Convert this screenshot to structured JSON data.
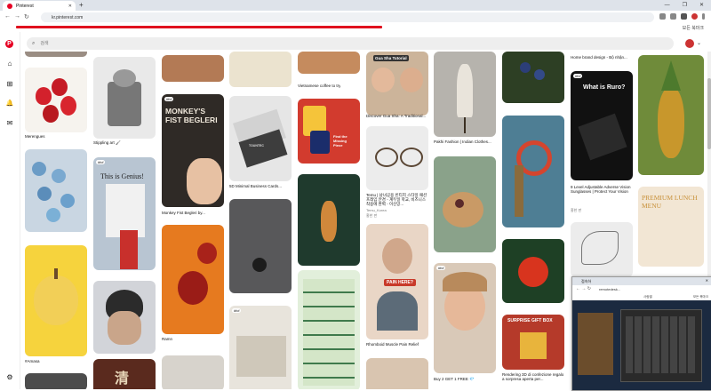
{
  "browser": {
    "tab_title": "Pinterest",
    "tab_close": "✕",
    "new_tab": "+",
    "url": "kr.pinterest.com",
    "bookmarks_label": "모든 북마크",
    "window_buttons": [
      "—",
      "❐",
      "✕"
    ],
    "colors": {
      "tabbar": "#dee3ea",
      "progress": "#e0101e",
      "brand": "#e60023"
    }
  },
  "sidebar": {
    "items": [
      {
        "name": "pinterest-logo-icon",
        "glyph": "P"
      },
      {
        "name": "home-icon",
        "glyph": "⌂"
      },
      {
        "name": "create-icon",
        "glyph": "⊞"
      },
      {
        "name": "notifications-icon",
        "glyph": "🔔"
      },
      {
        "name": "messages-icon",
        "glyph": "✉"
      },
      {
        "name": "settings-icon",
        "glyph": "⚙"
      }
    ]
  },
  "search": {
    "placeholder": "검색",
    "icon": "⌕"
  },
  "pins": {
    "c1": [
      "Merengues",
      "#Amasa"
    ],
    "c2": [
      "Stippling art 🖌",
      "This is Genius!",
      "#fcf",
      "清"
    ],
    "c3": [
      "MONKEY'S FIST BEGLERI",
      "Monkey Fist Begleri by...",
      "#fcf"
    ],
    "c4": [
      "5D Minimal Business Cards...",
      "TOUNTEC"
    ],
    "c5": [
      "Vietnamese coffee to try",
      "Find the Missing Piece",
      "Find the Missing Piece"
    ],
    "c6": [
      "Gua Sha Tutorial",
      "Discover Gua Sha: A Traditional...",
      "Temu | 남녀공용 빈티지 스타일 패션 프레임 안경 - 계두일 학교, 비즈니스 착용에 완벽 - 이신망...",
      "Temu_Korea",
      "홍한 판",
      "PAIN HERE?",
      "Rhomboid Muscle Pain Relief"
    ],
    "c7": [
      "Pakhi Fashion | Indian Clothes...",
      "Buy 2 GET 1 FREE 💎",
      "#fcf"
    ],
    "c8": [
      "Rendering 3D di confezione regalo a sorpresa aperta per...",
      "SURPRISE GIFT BOX"
    ],
    "c9": [
      "Home brand design - Bộ nhận...",
      "What is Ruro?",
      "9 Level Adjustable Adverse Vision Sunglasses | Protect Your Vision",
      "홍한 판",
      "PREMIUM LUNCH MENU"
    ],
    "misc": [
      "Ramn"
    ]
  },
  "popup": {
    "tab_title": "접속하",
    "url": "remotedesk...",
    "bookmarks": "모든 북마크",
    "bm_left": "사람별"
  },
  "avatar_chevron": "⌄"
}
